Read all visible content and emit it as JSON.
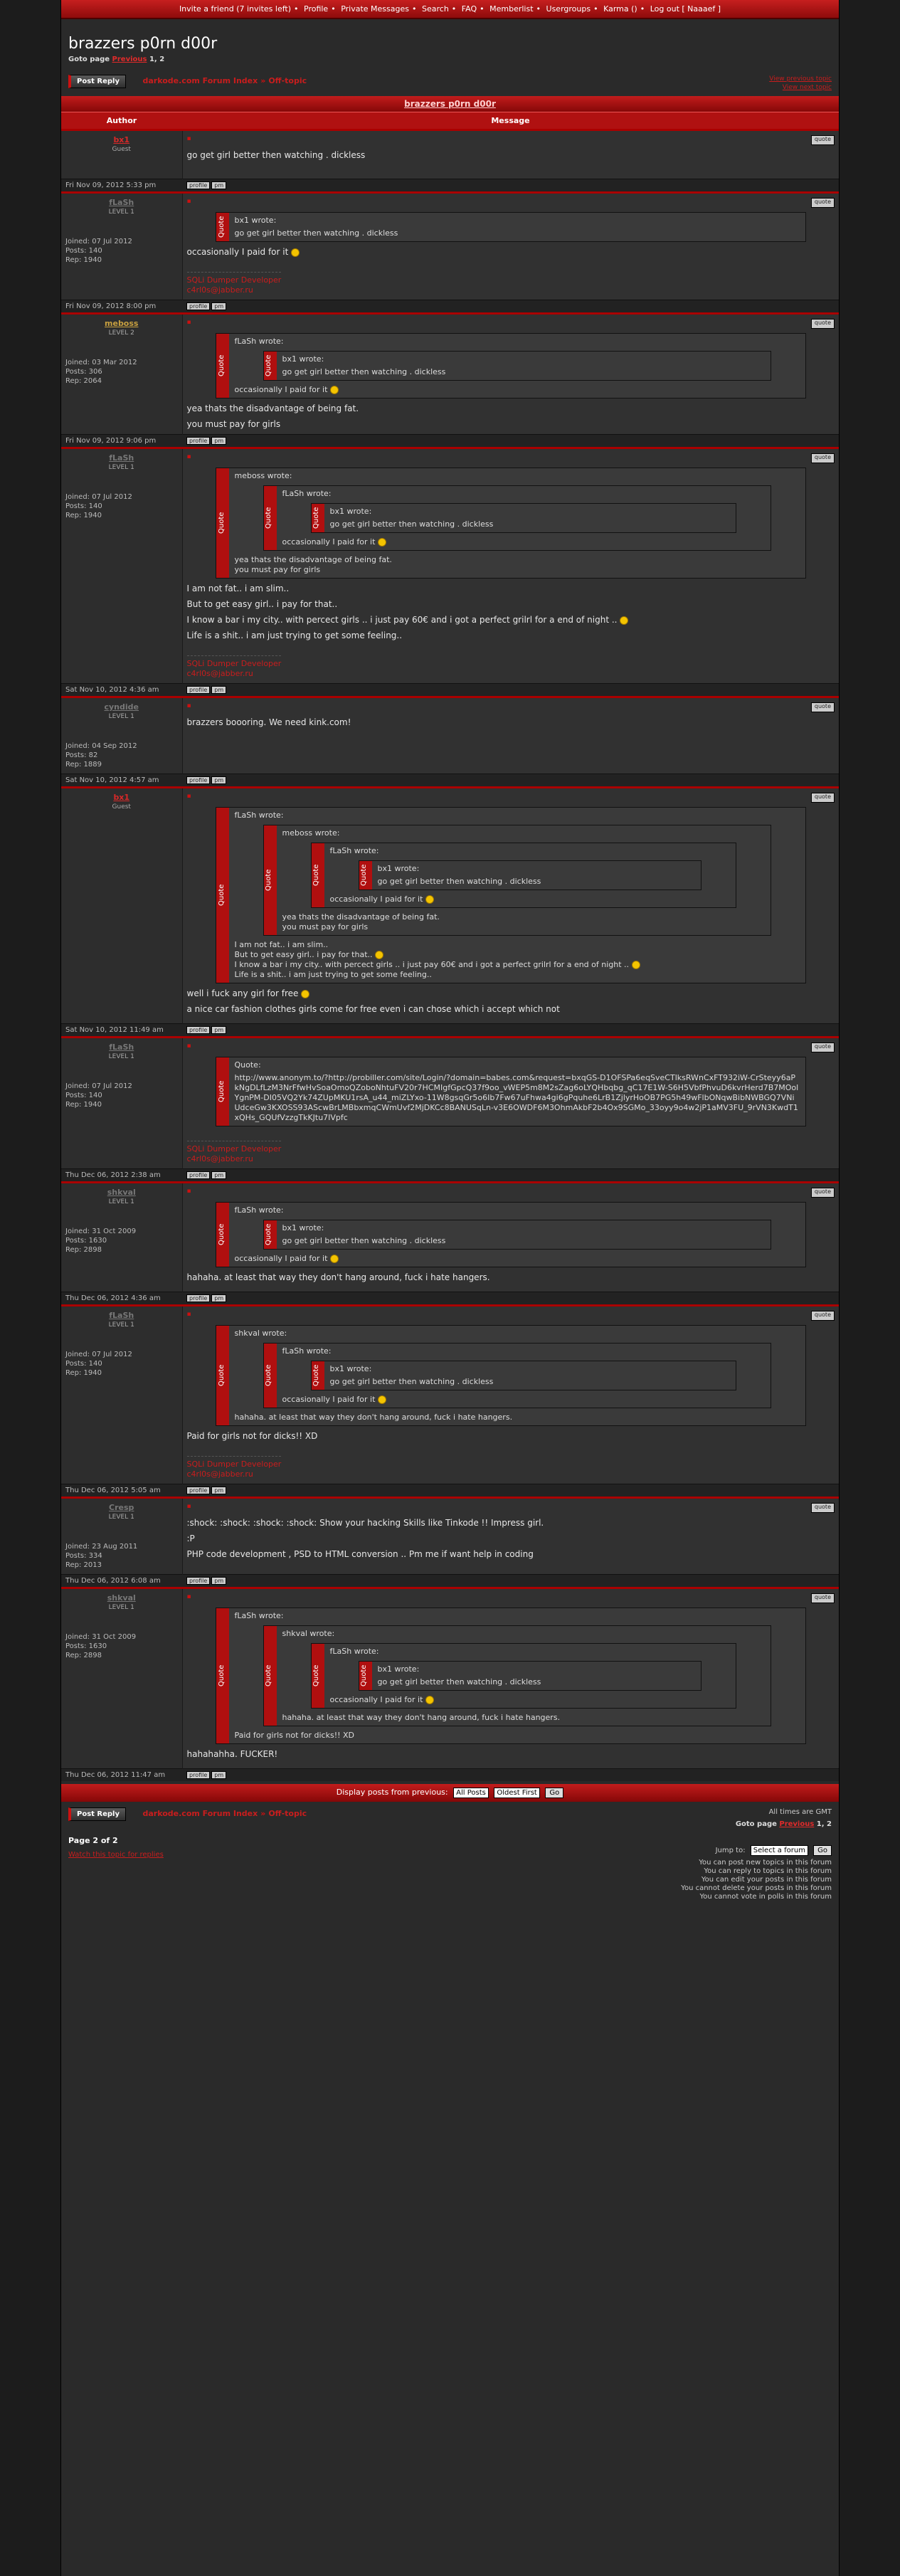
{
  "topnav": [
    "Invite a friend (7 invites left)",
    "Profile",
    "Private Messages",
    "Search",
    "FAQ",
    "Memberlist",
    "Usergroups",
    "Karma ()",
    "Log out [ Naaaef ]"
  ],
  "header": {
    "title": "brazzers p0rn d00r",
    "goto_label": "Goto page",
    "prev": "Previous",
    "pages": "1, 2"
  },
  "actions": {
    "post_reply": "Post Reply",
    "forum_index": "darkode.com Forum Index",
    "subforum": "Off-topic",
    "prev_topic": "View previous topic",
    "next_topic": "View next topic"
  },
  "table": {
    "topic_title": "brazzers p0rn d00r",
    "author_col": "Author",
    "message_col": "Message"
  },
  "sig": {
    "line1": "SQLi Dumper Developer",
    "line2": "c4rl0s@jabber.ru"
  },
  "posts": [
    {
      "name": "bx1",
      "name_color": "#d82828",
      "rank": "Guest",
      "stats": [],
      "date": "Fri Nov 09, 2012 5:33 pm",
      "text": "go get girl better then watching . dickless"
    },
    {
      "name": "fLaSh",
      "name_color": "#777777",
      "rank": "LEVEL 1",
      "stats": [
        "Joined: 07 Jul 2012",
        "Posts: 140",
        "Rep: 1940"
      ],
      "date": "Fri Nov 09, 2012 8:00 pm",
      "q1_title": "bx1 wrote:",
      "q1_text": "go get girl better then watching . dickless",
      "text": "occasionally I paid for it"
    },
    {
      "name": "meboss",
      "name_color": "#c8a040",
      "rank": "LEVEL 2",
      "stats": [
        "Joined: 03 Mar 2012",
        "Posts: 306",
        "Rep: 2064"
      ],
      "date": "Fri Nov 09, 2012 9:06 pm",
      "q1_title": "fLaSh wrote:",
      "q2_title": "bx1 wrote:",
      "q2_text": "go get girl better then watching . dickless",
      "q1_text": "occasionally I paid for it",
      "text1": "yea thats the disadvantage of being fat.",
      "text2": "you must pay for girls"
    },
    {
      "name": "fLaSh",
      "name_color": "#777777",
      "rank": "LEVEL 1",
      "stats": [
        "Joined: 07 Jul 2012",
        "Posts: 140",
        "Rep: 1940"
      ],
      "date": "Sat Nov 10, 2012 4:36 am",
      "q1_title": "meboss wrote:",
      "q2_title": "fLaSh wrote:",
      "q3_title": "bx1 wrote:",
      "q3_text": "go get girl better then watching . dickless",
      "q2_text": "occasionally I paid for it",
      "q1_text1": "yea thats the disadvantage of being fat.",
      "q1_text2": "you must pay for girls",
      "text1": "I am not fat.. i am slim..",
      "text2": "But to get easy girl.. i pay for that..",
      "text3": "I know a bar i my city.. with percect girls .. i just pay 60€ and i got a perfect grilrl for a end of night ..",
      "text4": "Life is a shit.. i am just trying to get some feeling.."
    },
    {
      "name": "cyndide",
      "name_color": "#777777",
      "rank": "LEVEL 1",
      "stats": [
        "Joined: 04 Sep 2012",
        "Posts: 82",
        "Rep: 1889"
      ],
      "date": "Sat Nov 10, 2012 4:57 am",
      "text": "brazzers boooring. We need kink.com!"
    },
    {
      "name": "bx1",
      "name_color": "#d82828",
      "rank": "Guest",
      "stats": [],
      "date": "Sat Nov 10, 2012 11:49 am",
      "q1_title": "fLaSh wrote:",
      "q2_title": "meboss wrote:",
      "q3_title": "fLaSh wrote:",
      "q4_title": "bx1 wrote:",
      "q4_text": "go get girl better then watching . dickless",
      "q3_text": "occasionally I paid for it",
      "q2_text1": "yea thats the disadvantage of being fat.",
      "q2_text2": "you must pay for girls",
      "q1_text1": "I am not fat.. i am slim..",
      "q1_text2": "But to get easy girl.. i pay for that..",
      "q1_text3": "I know a bar i my city.. with percect girls .. i just pay 60€ and i got a perfect grilrl for a end of night ..",
      "q1_text4": "Life is a shit.. i am just trying to get some feeling..",
      "text1": "well i fuck any girl for free",
      "text2": "a nice car fashion clothes girls come for free even i can chose which i accept which not"
    },
    {
      "name": "fLaSh",
      "name_color": "#777777",
      "rank": "LEVEL 1",
      "stats": [
        "Joined: 07 Jul 2012",
        "Posts: 140",
        "Rep: 1940"
      ],
      "date": "Thu Dec 06, 2012 2:38 am",
      "q1_title": "Quote:",
      "q1_text": "http://www.anonym.to/?http://probiller.com/site/Login/?domain=babes.com&request=bxqGS-D1OFSPa6eqSveCTlksRWnCxFT932iW-CrSteyy6aPkNgDLfLzM3NrFfwHvSoaOmoQZoboNhtuFV20r7HCMIgfGpcQ37f9oo_vWEP5m8M2sZag6oLYQHbqbg_qC17E1W-S6H5VbfPhvuD6kvrHerd7B7MOolYgnPM-DI05VQ2Yk74ZUpMKU1rsA_u44_miZLYxo-11W8gsqGr5o6Ib7Fw67uFhwa4gi6gPquhe6LrB1ZjlyrHoOB7PG5h49wFlbONqwBibNWBGQ7VNiUdceGw3KXOSS93AScwBrLMBbxmqCWmUvf2MjDKCc8BANUSqLn-v3E6OWDF6M3OhmAkbF2b4Ox9SGMo_33oyy9o4w2jP1aMV3FU_9rVN3KwdT1xQHs_GQUfVzzgTkKJtu7IVpfc"
    },
    {
      "name": "shkval",
      "name_color": "#777777",
      "rank": "LEVEL 1",
      "stats": [
        "Joined: 31 Oct 2009",
        "Posts: 1630",
        "Rep: 2898"
      ],
      "date": "Thu Dec 06, 2012 4:36 am",
      "q1_title": "fLaSh wrote:",
      "q2_title": "bx1 wrote:",
      "q2_text": "go get girl better then watching . dickless",
      "q1_text": "occasionally I paid for it",
      "text": "hahaha. at least that way they don't hang around, fuck i hate hangers."
    },
    {
      "name": "fLaSh",
      "name_color": "#777777",
      "rank": "LEVEL 1",
      "stats": [
        "Joined: 07 Jul 2012",
        "Posts: 140",
        "Rep: 1940"
      ],
      "date": "Thu Dec 06, 2012 5:05 am",
      "q1_title": "shkval wrote:",
      "q2_title": "fLaSh wrote:",
      "q3_title": "bx1 wrote:",
      "q3_text": "go get girl better then watching . dickless",
      "q2_text": "occasionally I paid for it",
      "q1_text": "hahaha. at least that way they don't hang around, fuck i hate hangers.",
      "text": "Paid for girls not for dicks!! XD"
    },
    {
      "name": "Cresp",
      "name_color": "#777777",
      "rank": "LEVEL 1",
      "stats": [
        "Joined: 23 Aug 2011",
        "Posts: 334",
        "Rep: 2013"
      ],
      "date": "Thu Dec 06, 2012 6:08 am",
      "text1": ":shock: :shock: :shock: :shock: Show your hacking Skills like Tinkode !! Impress girl.",
      "text2": ":P",
      "text3": "PHP code development , PSD to HTML conversion .. Pm me if want help in coding"
    },
    {
      "name": "shkval",
      "name_color": "#777777",
      "rank": "LEVEL 1",
      "stats": [
        "Joined: 31 Oct 2009",
        "Posts: 1630",
        "Rep: 2898"
      ],
      "date": "Thu Dec 06, 2012 11:47 am",
      "q1_title": "fLaSh wrote:",
      "q2_title": "shkval wrote:",
      "q3_title": "fLaSh wrote:",
      "q4_title": "bx1 wrote:",
      "q4_text": "go get girl better then watching . dickless",
      "q3_text": "occasionally I paid for it",
      "q2_text": "hahaha. at least that way they don't hang around, fuck i hate hangers.",
      "q1_text": "Paid for girls not for dicks!! XD",
      "text": "hahahahha. FUCKER!"
    }
  ],
  "quote_side": "Quote",
  "btn": {
    "quote": "quote",
    "profile": "profile",
    "pm": "pm",
    "www": "www"
  },
  "display": {
    "label": "Display posts from previous:",
    "sel1": "All Posts",
    "sel2": "Oldest First",
    "go": "Go"
  },
  "bottom": {
    "timezone": "All times are GMT",
    "goto_label": "Goto page",
    "prev": "Previous",
    "pages": "1, 2",
    "pageof": "Page 2 of 2",
    "watch": "Watch this topic for replies",
    "jump_label": "Jump to:",
    "jump_sel": "Select a forum",
    "jump_go": "Go",
    "perms": [
      "You can post new topics in this forum",
      "You can reply to topics in this forum",
      "You can edit your posts in this forum",
      "You cannot delete your posts in this forum",
      "You cannot vote in polls in this forum"
    ]
  }
}
